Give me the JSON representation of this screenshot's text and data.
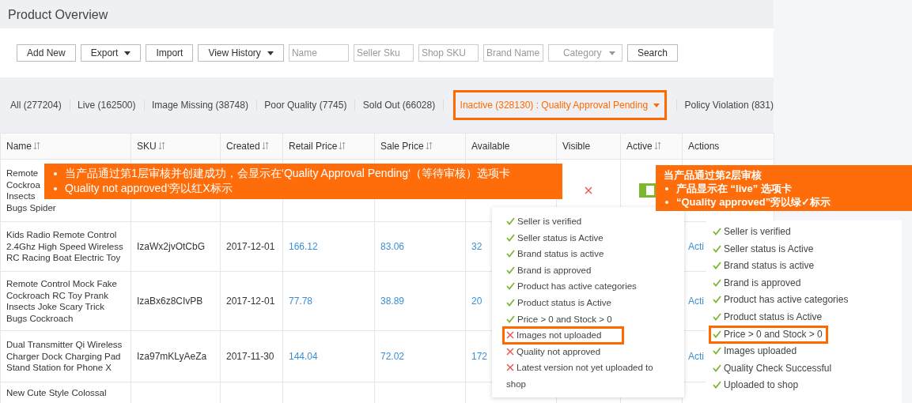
{
  "page_title": "Product Overview",
  "toolbar": {
    "buttons": [
      {
        "label": "Add New",
        "dropdown": false
      },
      {
        "label": "Export",
        "dropdown": true
      },
      {
        "label": "Import",
        "dropdown": false
      },
      {
        "label": "View History",
        "dropdown": true
      }
    ],
    "filters": [
      {
        "placeholder": "Name",
        "kind": "input"
      },
      {
        "placeholder": "Seller Sku",
        "kind": "input"
      },
      {
        "placeholder": "Shop SKU",
        "kind": "input"
      },
      {
        "placeholder": "Brand Name",
        "kind": "input"
      },
      {
        "placeholder": "Category",
        "kind": "select"
      }
    ],
    "search_button": "Search"
  },
  "status_tabs": [
    {
      "label": "All (277204)",
      "selected": false,
      "dropdown": false
    },
    {
      "label": "Live (162500)",
      "selected": false,
      "dropdown": false
    },
    {
      "label": "Image Missing (38748)",
      "selected": false,
      "dropdown": false
    },
    {
      "label": "Poor Quality (7745)",
      "selected": false,
      "dropdown": false
    },
    {
      "label": "Sold Out (66028)",
      "selected": false,
      "dropdown": false
    },
    {
      "label": "Inactive (328130) : Quality Approval Pending",
      "selected": true,
      "dropdown": true
    },
    {
      "label": "Policy Violation (831)",
      "selected": false,
      "dropdown": false
    }
  ],
  "table": {
    "columns": [
      {
        "label": "Name",
        "sortable": true
      },
      {
        "label": "SKU",
        "sortable": true
      },
      {
        "label": "Created",
        "sortable": true
      },
      {
        "label": "Retail Price",
        "sortable": true
      },
      {
        "label": "Sale Price",
        "sortable": true
      },
      {
        "label": "Available",
        "sortable": false
      },
      {
        "label": "Visible",
        "sortable": false
      },
      {
        "label": "Active",
        "sortable": true
      },
      {
        "label": "Actions",
        "sortable": false
      }
    ],
    "rows": [
      {
        "name": [
          "Remote",
          "Cockroa",
          "Insects",
          "Bugs Spider"
        ],
        "visible": false,
        "active": true
      },
      {
        "name": [
          "Kids Radio Remote Control",
          "2.4Ghz High Speed Wireless",
          "RC Racing Boat Electric Toy"
        ],
        "sku": "IzaWx2jvOtCbG",
        "created": "2017-12-01",
        "retail_price": "166.12",
        "sale_price": "83.06",
        "available": "32",
        "action": "Acti"
      },
      {
        "name": [
          "Remote Control Mock Fake",
          "Cockroach RC Toy Prank",
          "Insects Joke Scary Trick",
          "Bugs Cockroach"
        ],
        "sku": "IzaBx6z8CIvPB",
        "created": "2017-12-01",
        "retail_price": "77.78",
        "sale_price": "38.89",
        "available": "20",
        "action": "Acti"
      },
      {
        "name": [
          "Dual Transmitter Qi Wireless",
          "Charger Dock Charging Pad",
          "Stand Station for Phone X"
        ],
        "sku": "Iza97mKLyAeZa",
        "created": "2017-11-30",
        "retail_price": "144.04",
        "sale_price": "72.02",
        "available": "172",
        "action": "Acti"
      },
      {
        "name": [
          "New Cute Style Colossal"
        ]
      }
    ]
  },
  "callouts": [
    {
      "bullets": [
        "当产品通过第1层审核并创建成功，会显示在‘Quality Approval Pending‘（等待审核）选项卡",
        "Quality not approved‘旁以红X标示"
      ]
    },
    {
      "title": "当产品通过第2层审核",
      "bullets": [
        "产品显示在 “live” 选项卡",
        "“Quality approved”旁以绿✓标示"
      ]
    }
  ],
  "popovers": [
    {
      "items": [
        {
          "text": "Seller is verified",
          "kind": "pass",
          "highlighted": false
        },
        {
          "text": "Seller status is Active",
          "kind": "pass",
          "highlighted": false
        },
        {
          "text": "Brand status is active",
          "kind": "pass",
          "highlighted": false
        },
        {
          "text": "Brand is approved",
          "kind": "pass",
          "highlighted": false
        },
        {
          "text": "Product has active categories",
          "kind": "pass",
          "highlighted": false
        },
        {
          "text": "Product status is Active",
          "kind": "pass",
          "highlighted": false
        },
        {
          "text": "Price > 0 and Stock > 0",
          "kind": "pass",
          "highlighted": false
        },
        {
          "text": "Images not uploaded",
          "kind": "fail",
          "highlighted": true
        },
        {
          "text": "Quality not approved",
          "kind": "fail",
          "highlighted": false
        },
        {
          "text": "Latest version not yet uploaded to shop",
          "kind": "fail",
          "highlighted": false
        }
      ]
    },
    {
      "items": [
        {
          "text": "Seller is verified",
          "kind": "pass",
          "highlighted": false
        },
        {
          "text": "Seller status is Active",
          "kind": "pass",
          "highlighted": false
        },
        {
          "text": "Brand status is active",
          "kind": "pass",
          "highlighted": false
        },
        {
          "text": "Brand is approved",
          "kind": "pass",
          "highlighted": false
        },
        {
          "text": "Product has active categories",
          "kind": "pass",
          "highlighted": false
        },
        {
          "text": "Product status is Active",
          "kind": "pass",
          "highlighted": false
        },
        {
          "text": "Price > 0 and Stock > 0",
          "kind": "pass",
          "highlighted": true
        },
        {
          "text": "Images uploaded",
          "kind": "pass",
          "highlighted": false
        },
        {
          "text": "Quality Check Successful",
          "kind": "pass",
          "highlighted": false
        },
        {
          "text": "Uploaded to shop",
          "kind": "pass",
          "highlighted": false
        }
      ]
    }
  ]
}
